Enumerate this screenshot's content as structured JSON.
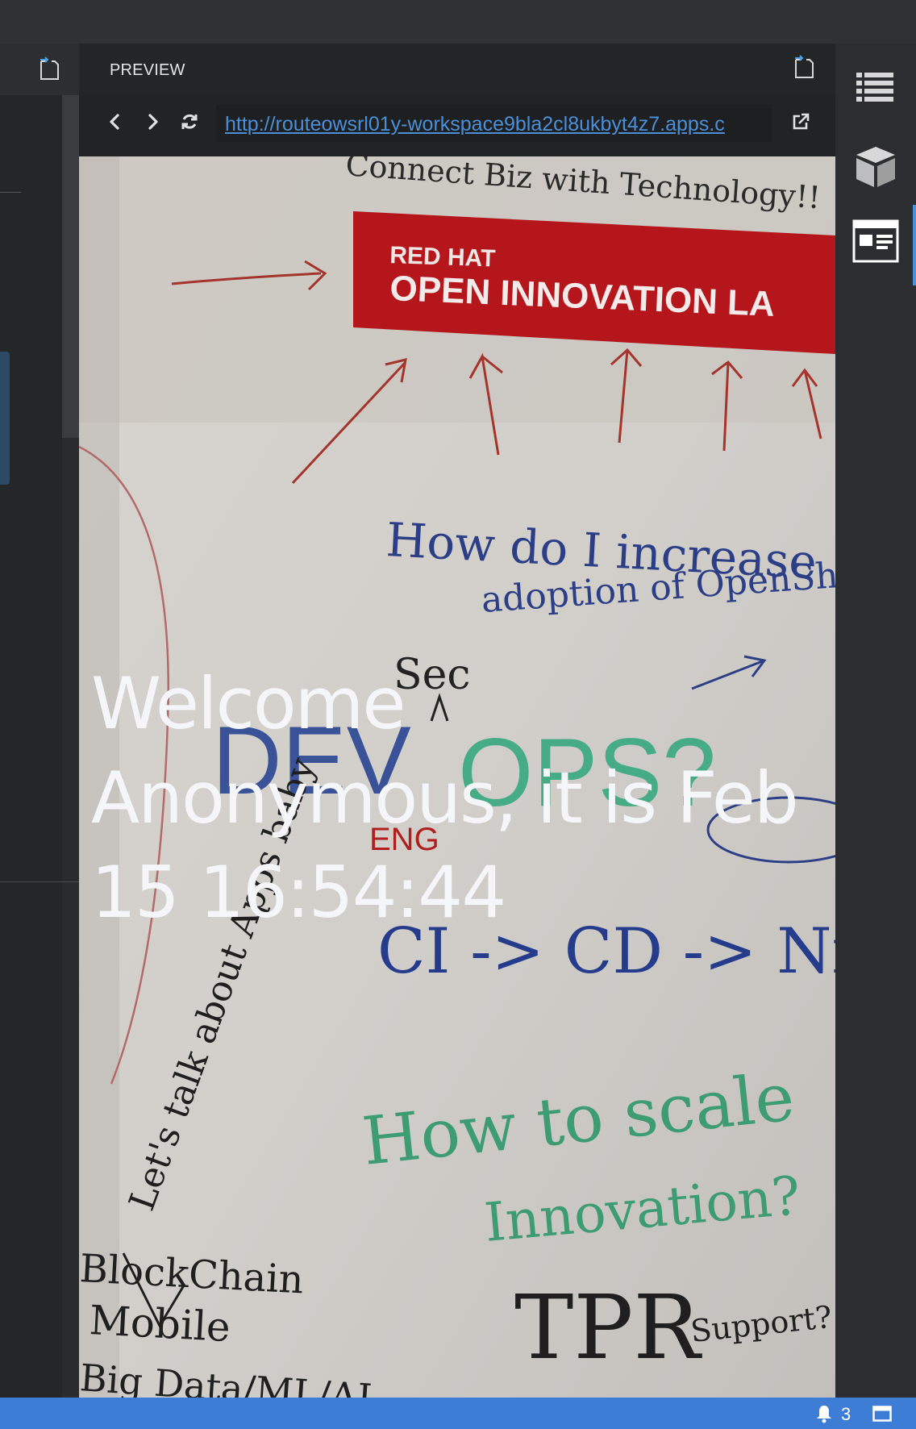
{
  "preview": {
    "title": "PREVIEW",
    "url": "http://routeowsrl01y-workspace9bla2cl8ukbyt4z7.apps.c"
  },
  "page": {
    "welcome_text": "Welcome Anonymous, it is Feb 15 16:54:44"
  },
  "whiteboard": {
    "top_text": "Connect Biz with Technology!!",
    "banner_line1": "RED HAT",
    "banner_line2": "OPEN INNOVATION LA",
    "note1_line1": "How do I increase",
    "note1_line2": "adoption of OpenShi",
    "sec": "Sec",
    "dev": "DEV",
    "ops": "OPS?",
    "eng": "ENG",
    "ci_cd": "CI -> CD -> Nirva",
    "scale_line1": "How to scale",
    "scale_line2": "Innovation?",
    "side_text": "Let's talk about Apps baby",
    "list1": "BlockChain",
    "list2": "Mobile",
    "list3": "Big Data/ML/AI",
    "tpr": "TPR",
    "support": "Support?"
  },
  "statusbar": {
    "notification_count": "3"
  },
  "colors": {
    "accent": "#3e7dd6",
    "link": "#4b8fd8",
    "banner_red": "#b5161b"
  }
}
